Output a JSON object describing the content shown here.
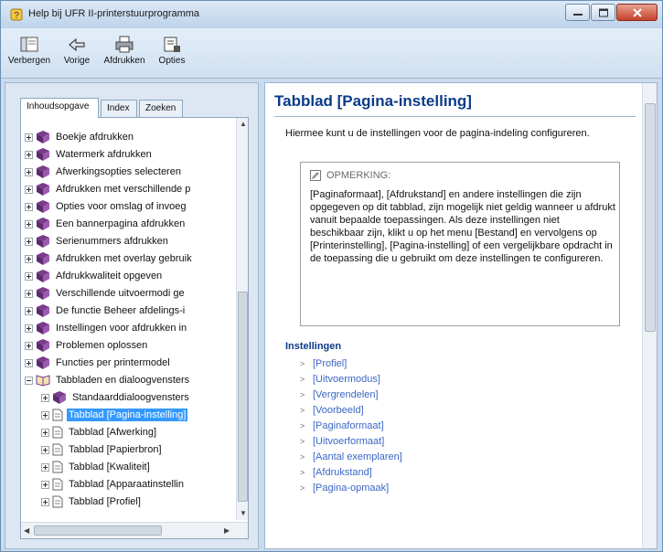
{
  "window": {
    "title": "Help bij UFR II-printerstuurprogramma"
  },
  "toolbar": {
    "hide_label": "Verbergen",
    "back_label": "Vorige",
    "print_label": "Afdrukken",
    "options_label": "Opties"
  },
  "left_tabs": [
    "Inhoudsopgave",
    "Index",
    "Zoeken"
  ],
  "tree": [
    "Boekje afdrukken",
    "Watermerk afdrukken",
    "Afwerkingsopties selecteren",
    "Afdrukken met verschillende p",
    "Opties voor omslag of invoeg",
    "Een bannerpagina afdrukken",
    "Serienummers afdrukken",
    "Afdrukken met overlay gebruik",
    "Afdrukkwaliteit opgeven",
    "Verschillende uitvoermodi ge",
    "De functie Beheer afdelings-i",
    "Instellingen voor afdrukken in",
    "Problemen oplossen",
    "Functies per printermodel",
    "Tabbladen en dialoogvensters",
    "Standaarddialoogvensters",
    "Tabblad [Pagina-instelling]",
    "Tabblad [Afwerking]",
    "Tabblad [Papierbron]",
    "Tabblad [Kwaliteit]",
    "Tabblad [Apparaatinstellin",
    "Tabblad [Profiel]"
  ],
  "content": {
    "heading": "Tabblad [Pagina-instelling]",
    "intro": "Hiermee kunt u de instellingen voor de pagina-indeling configureren.",
    "note_title": "OPMERKING:",
    "note_body": "[Paginaformaat], [Afdrukstand] en andere instellingen die zijn opgegeven op dit tabblad, zijn mogelijk niet geldig wanneer u afdrukt vanuit bepaalde toepassingen. Als deze instellingen niet beschikbaar zijn, klikt u op het menu [Bestand] en vervolgens op [Printerinstelling], [Pagina-instelling] of een vergelijkbare opdracht in de toepassing die u gebruikt om deze instellingen te configureren.",
    "settings_title": "Instellingen",
    "links": [
      "[Profiel]",
      "[Uitvoermodus]",
      "[Vergrendelen]",
      "[Voorbeeld]",
      "[Paginaformaat]",
      "[Uitvoerformaat]",
      "[Aantal exemplaren]",
      "[Afdrukstand]",
      "[Pagina-opmaak]"
    ]
  },
  "colors": {
    "heading": "#0b3b8a",
    "link": "#3b66c5",
    "selection": "#3399ff"
  }
}
